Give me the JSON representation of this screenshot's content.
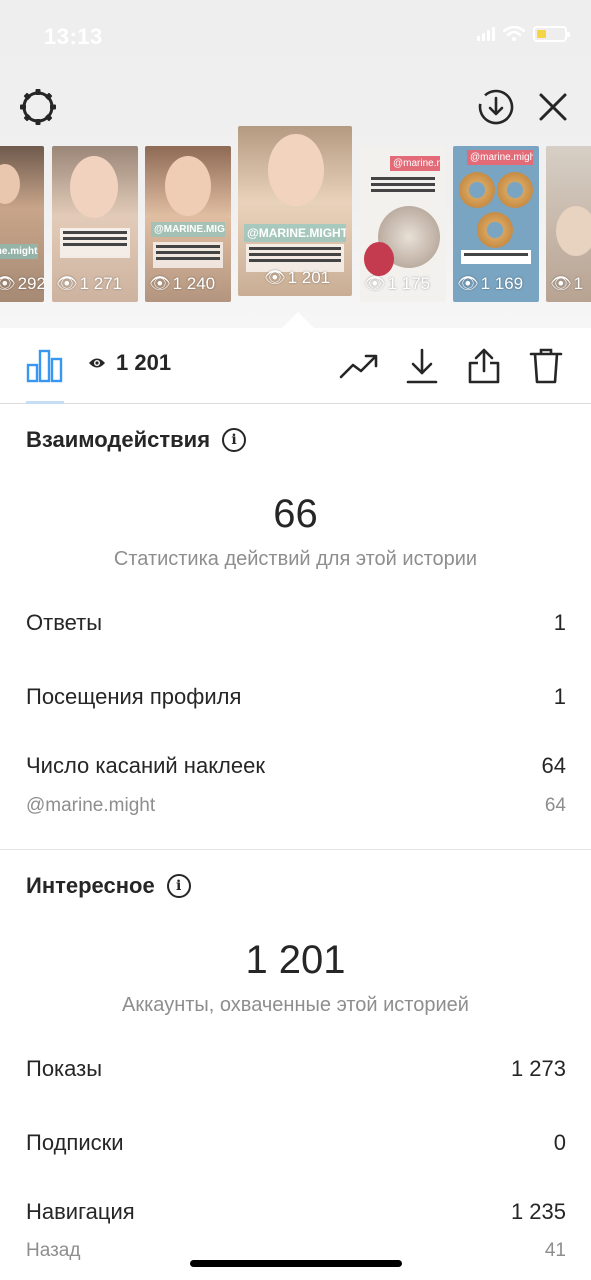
{
  "status_bar": {
    "time": "13:13",
    "battery_level": 0.35
  },
  "thumbnails": [
    {
      "views": "292",
      "tag": "ine.might"
    },
    {
      "views": "1 271",
      "tag": ""
    },
    {
      "views": "1 240",
      "tag": "@MARINE.MIGHT"
    },
    {
      "views": "1 201",
      "tag": "@MARINE.MIGHT",
      "selected": true
    },
    {
      "views": "1 175",
      "tag": "@marine.might"
    },
    {
      "views": "1 169",
      "tag": "@marine.might"
    },
    {
      "views": "1",
      "tag": ""
    }
  ],
  "toolbar": {
    "views": "1 201"
  },
  "interactions": {
    "title": "Взаимодействия",
    "total": "66",
    "caption": "Статистика действий для этой истории",
    "rows": [
      {
        "label": "Ответы",
        "value": "1"
      },
      {
        "label": "Посещения профиля",
        "value": "1"
      },
      {
        "label": "Число касаний наклеек",
        "value": "64"
      }
    ],
    "sub_row": {
      "label": "@marine.might",
      "value": "64"
    }
  },
  "discovery": {
    "title": "Интересное",
    "total": "1 201",
    "caption": "Аккаунты, охваченные этой историей",
    "rows": [
      {
        "label": "Показы",
        "value": "1 273"
      },
      {
        "label": "Подписки",
        "value": "0"
      },
      {
        "label": "Навигация",
        "value": "1 235"
      }
    ],
    "sub_row": {
      "label": "Назад",
      "value": "41"
    }
  },
  "icons": {
    "settings": "settings-gear-icon",
    "download_circle": "download-circle-icon",
    "close": "close-icon",
    "insights": "insights-bar-chart-icon",
    "eye": "eye-icon",
    "promote": "trending-up-icon",
    "download": "download-icon",
    "share": "share-icon",
    "delete": "trash-icon",
    "info": "info-icon"
  },
  "colors": {
    "accent": "#3897f0",
    "text": "#262626",
    "muted": "#8e8e8e"
  }
}
